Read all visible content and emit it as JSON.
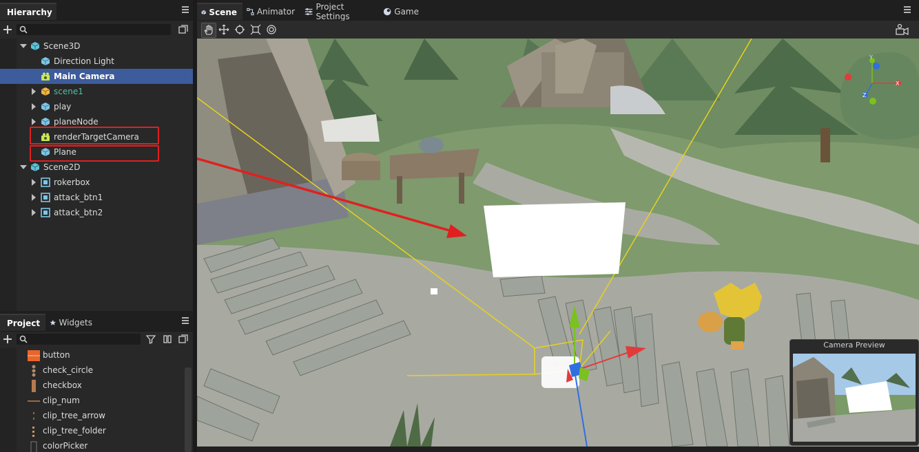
{
  "hierarchy": {
    "tab_label": "Hierarchy",
    "search_placeholder": "",
    "items": [
      {
        "label": "Scene3D",
        "depth": 0,
        "expanded": true,
        "icon": "scene-cube-icon"
      },
      {
        "label": "Direction Light",
        "depth": 1,
        "icon": "cube-icon"
      },
      {
        "label": "Main Camera",
        "depth": 1,
        "icon": "camera-icon",
        "selected": true
      },
      {
        "label": "scene1",
        "depth": 1,
        "icon": "prefab-cube-icon",
        "collapsed": true,
        "color": "#4fc1a0"
      },
      {
        "label": "play",
        "depth": 1,
        "icon": "cube-icon",
        "collapsed": true
      },
      {
        "label": "planeNode",
        "depth": 1,
        "icon": "cube-icon",
        "collapsed": true
      },
      {
        "label": "renderTargetCamera",
        "depth": 1,
        "icon": "camera-icon",
        "highlighted": true
      },
      {
        "label": "Plane",
        "depth": 1,
        "icon": "cube-icon",
        "highlighted": true
      },
      {
        "label": "Scene2D",
        "depth": 0,
        "expanded": true,
        "icon": "scene-cube-icon"
      },
      {
        "label": "rokerbox",
        "depth": 1,
        "icon": "box2d-icon",
        "collapsed": true
      },
      {
        "label": "attack_btn1",
        "depth": 1,
        "icon": "box2d-icon",
        "collapsed": true
      },
      {
        "label": "attack_btn2",
        "depth": 1,
        "icon": "box2d-icon",
        "collapsed": true
      }
    ]
  },
  "project": {
    "tabs": [
      {
        "label": "Project",
        "active": true
      },
      {
        "label": "Widgets",
        "active": false
      }
    ],
    "search_placeholder": "",
    "items": [
      {
        "label": "button",
        "thumb": "button-thumb"
      },
      {
        "label": "check_circle",
        "thumb": "check-circle-thumb"
      },
      {
        "label": "checkbox",
        "thumb": "checkbox-thumb"
      },
      {
        "label": "clip_num",
        "thumb": "clip-num-thumb"
      },
      {
        "label": "clip_tree_arrow",
        "thumb": "clip-tree-arrow-thumb"
      },
      {
        "label": "clip_tree_folder",
        "thumb": "clip-tree-folder-thumb"
      },
      {
        "label": "colorPicker",
        "thumb": "color-picker-thumb"
      }
    ]
  },
  "editor": {
    "tabs": [
      {
        "label": "Scene",
        "active": true,
        "icon": "scene-icon"
      },
      {
        "label": "Animator",
        "active": false,
        "icon": "animator-icon"
      },
      {
        "label": "Project Settings",
        "active": false,
        "icon": "settings-sliders-icon"
      },
      {
        "label": "Game",
        "active": false,
        "icon": "game-icon"
      }
    ],
    "tools": [
      "hand-tool-icon",
      "move-tool-icon",
      "rotate-tool-icon",
      "scale-tool-icon",
      "rect-tool-icon"
    ],
    "camera_preview_title": "Camera Preview",
    "gizmo_axes": {
      "x": "X",
      "y": "Y",
      "z": "Z"
    }
  },
  "colors": {
    "selection": "#3d5c9c",
    "highlight_box": "#e02020",
    "annotation_arrow": "#e02020",
    "camera_frustum": "#e8d21e"
  }
}
